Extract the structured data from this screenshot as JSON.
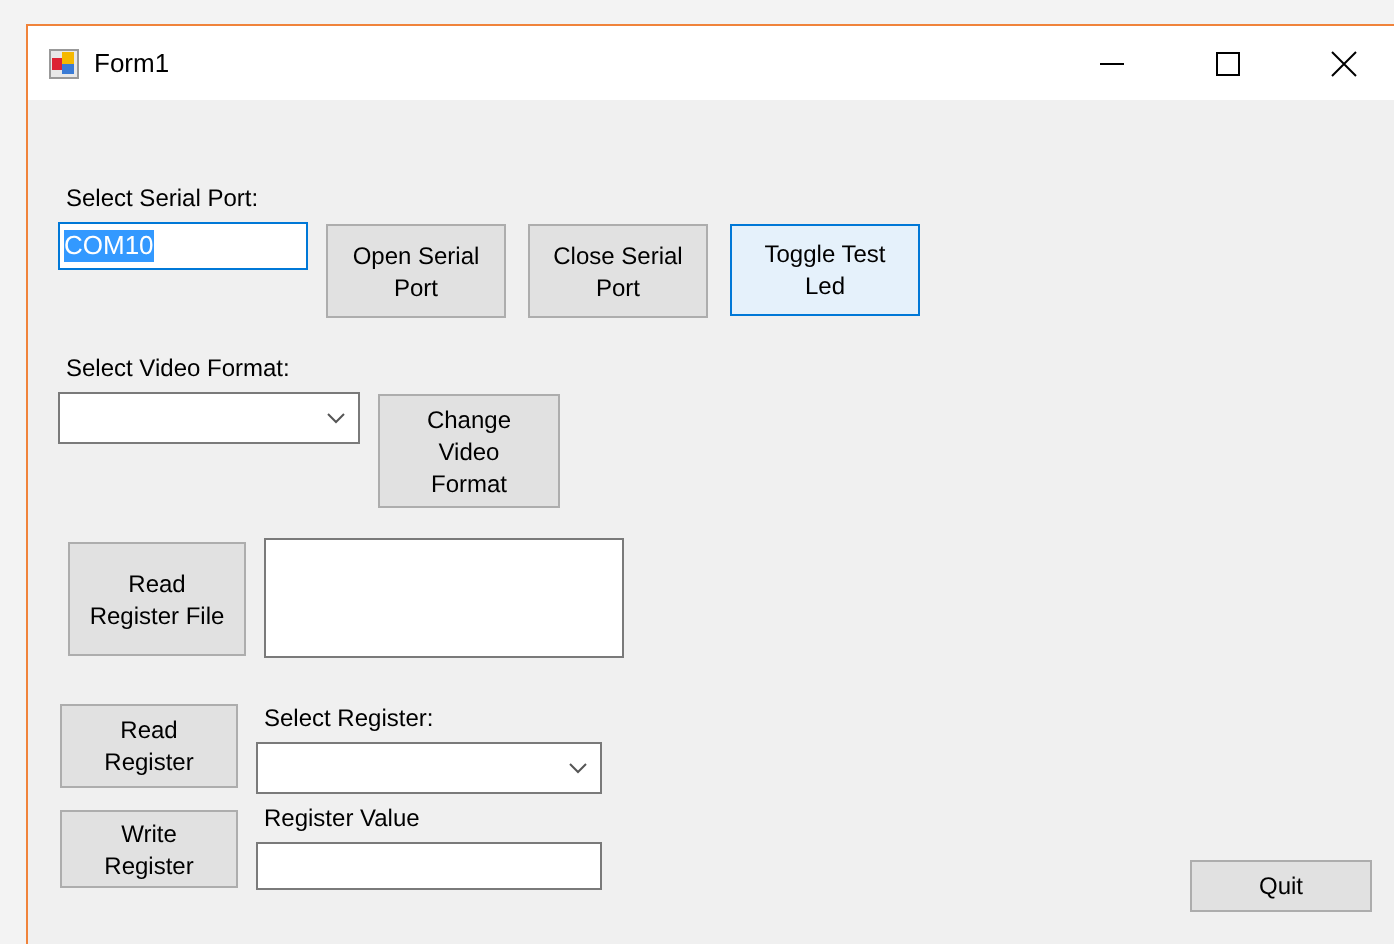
{
  "window": {
    "title": "Form1"
  },
  "controls": [
    {
      "kind": "label",
      "text": "Select Serial Port:"
    },
    {
      "kind": "textbox",
      "value": "COM10",
      "text_selected": true
    },
    {
      "kind": "button",
      "text": "Open Serial Port",
      "focused": false
    },
    {
      "kind": "button",
      "text": "Close Serial Port",
      "focused": false
    },
    {
      "kind": "button",
      "text": "Toggle Test Led",
      "focused": true
    },
    {
      "kind": "label",
      "text": "Select Video Format:"
    },
    {
      "kind": "combobox"
    },
    {
      "kind": "button",
      "text": "Change Video Format",
      "focused": false
    },
    {
      "kind": "button",
      "text": "Read Register File",
      "focused": false
    },
    {
      "kind": "textarea"
    },
    {
      "kind": "button",
      "text": "Read Register",
      "focused": false
    },
    {
      "kind": "label",
      "text": "Select Register:"
    },
    {
      "kind": "combobox"
    },
    {
      "kind": "button",
      "text": "Write Register",
      "focused": false
    },
    {
      "kind": "label",
      "text": "Register Value"
    },
    {
      "kind": "textbox",
      "text_selected": false
    },
    {
      "kind": "button",
      "text": "Quit",
      "focused": false
    }
  ]
}
